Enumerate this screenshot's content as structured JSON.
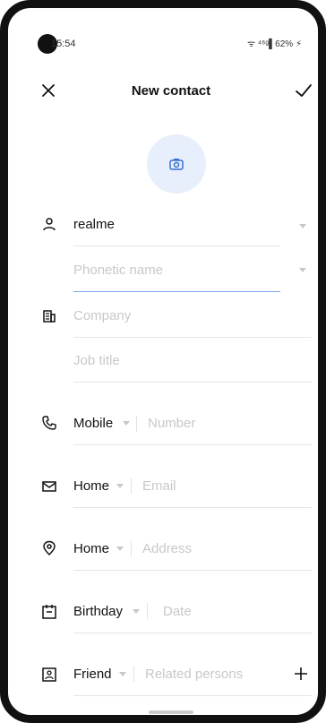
{
  "status": {
    "time": "15:54",
    "right_text": "ᯤ ⁴⁶ᵍ▌62% ⚡"
  },
  "header": {
    "title": "New contact"
  },
  "fields": {
    "name": {
      "value": "realme"
    },
    "phonetic": {
      "placeholder": "Phonetic name"
    },
    "company": {
      "placeholder": "Company"
    },
    "job": {
      "placeholder": "Job title"
    },
    "phone": {
      "type": "Mobile",
      "placeholder": "Number"
    },
    "email": {
      "type": "Home",
      "placeholder": "Email"
    },
    "address": {
      "type": "Home",
      "placeholder": "Address"
    },
    "event": {
      "type": "Birthday",
      "placeholder": "Date"
    },
    "related": {
      "type": "Friend",
      "placeholder": "Related persons"
    }
  }
}
